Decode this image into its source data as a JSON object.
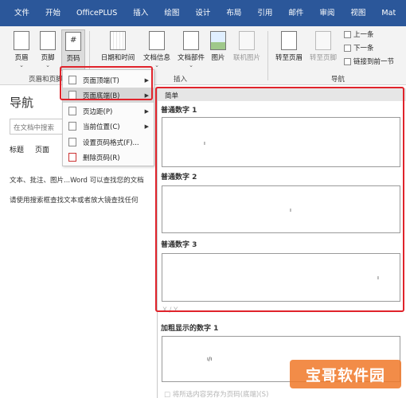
{
  "tabs": [
    "文件",
    "开始",
    "OfficePLUS",
    "插入",
    "绘图",
    "设计",
    "布局",
    "引用",
    "邮件",
    "审阅",
    "视图",
    "Mat"
  ],
  "ribbon": {
    "header_btn": "页眉",
    "footer_btn": "页脚",
    "pagenum_btn": "页码",
    "datetime_btn": "日期和时间",
    "docinfo_btn": "文档信息",
    "docparts_btn": "文档部件",
    "picture_btn": "图片",
    "online_pic_btn": "联机图片",
    "goto_header_btn": "转至页眉",
    "goto_footer_btn": "转至页脚",
    "prev_cmd": "上一条",
    "next_cmd": "下一条",
    "link_prev_cmd": "链接到前一节",
    "group_header_footer": "页眉和页脚",
    "group_insert": "插入",
    "group_nav": "导航"
  },
  "nav": {
    "title": "导航",
    "search_placeholder": "在文档中搜索",
    "tab_headings": "标题",
    "tab_pages": "页面",
    "line1": "文本、批注、图片...Word 可以查找您的文档",
    "line2": "请使用搜索框查找文本或者放大镜查找任何"
  },
  "menu": {
    "items": [
      {
        "label": "页面顶端(T)",
        "sub": true
      },
      {
        "label": "页面底端(B)",
        "sub": true
      },
      {
        "label": "页边距(P)",
        "sub": true
      },
      {
        "label": "当前位置(C)",
        "sub": true
      },
      {
        "label": "设置页码格式(F)...",
        "sub": false
      },
      {
        "label": "删除页码(R)",
        "sub": false
      }
    ]
  },
  "gallery": {
    "header": "简单",
    "items": [
      "普通数字 1",
      "普通数字 2",
      "普通数字 3"
    ],
    "section2": "X / Y",
    "item4": "加粗显示的数字 1",
    "bottom_text": "将所选内容另存为页码(底端)(S)"
  },
  "watermark": "宝哥软件园",
  "colors": {
    "accent": "#2b579a",
    "highlight": "#e0232b"
  }
}
